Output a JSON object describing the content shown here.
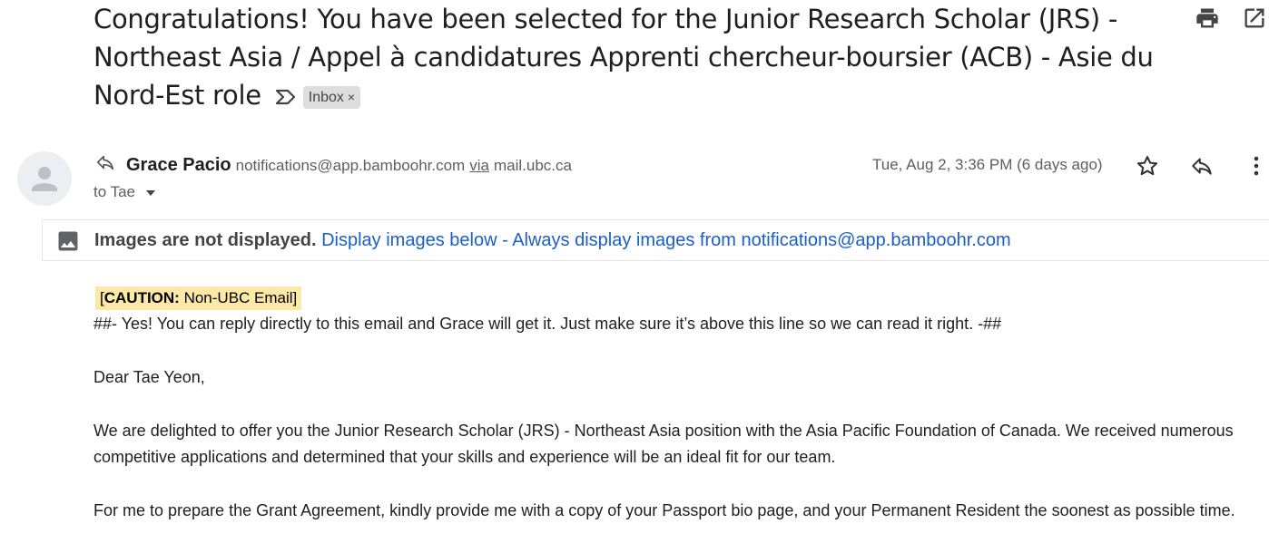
{
  "subject": {
    "text": "Congratulations!  You have been selected for the Junior Research Scholar (JRS) - Northeast Asia / Appel à candidatures Apprenti chercheur-boursier (ACB) - Asie du Nord-Est  role",
    "label": "Inbox",
    "label_remove": "×"
  },
  "toolbar": {
    "print_icon": "print-icon",
    "open_new_window_icon": "open-in-new-icon"
  },
  "message": {
    "sender_name": "Grace Pacio",
    "sender_email": "notifications@app.bamboohr.com",
    "via_label": "via",
    "via_domain": "mail.ubc.ca",
    "to_text": "to Tae",
    "date": "Tue, Aug 2, 3:36 PM (6 days ago)"
  },
  "images_bar": {
    "bold_text": "Images are not displayed.",
    "display_below": "Display images below",
    "separator": " - ",
    "always_display": "Always display images from notifications@app.bamboohr.com"
  },
  "body": {
    "caution_open": "[",
    "caution_bold": "CAUTION:",
    "caution_rest": " Non-UBC Email]",
    "reply_line": "##- Yes! You can reply directly to this email and Grace will get it. Just make sure it’s above this line so we can read it right. -##",
    "greeting": "Dear Tae Yeon,",
    "para1": "We are delighted to offer you the Junior Research Scholar (JRS) - Northeast Asia position with the Asia Pacific Foundation of Canada.  We received numerous competitive applications and determined that your skills and experience will be an ideal fit for our team.",
    "para2": "For me to prepare the Grant Agreement,  kindly provide me with a copy of your Passport bio page, and your Permanent Resident the soonest as possible time."
  },
  "colors": {
    "link": "#1a5fc9",
    "caution_bg": "#fde9a7",
    "chip_bg": "#dddddd"
  }
}
